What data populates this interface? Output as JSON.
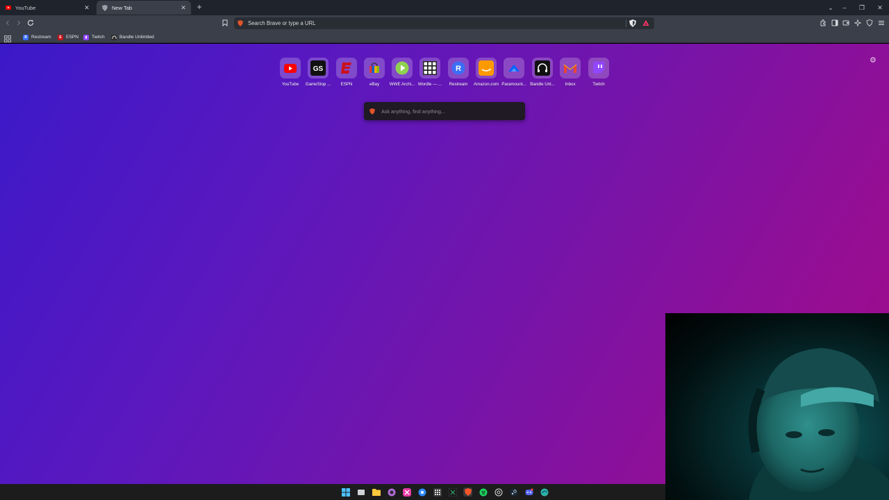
{
  "tabs": [
    {
      "title": "YouTube",
      "active": false,
      "favicon": "youtube-icon"
    },
    {
      "title": "New Tab",
      "active": true,
      "favicon": "brave-shield-icon"
    }
  ],
  "toolbar": {
    "omnibox_placeholder": "Search Brave or type a URL"
  },
  "bookmarks": [
    {
      "label": "Restream",
      "icon": "restream-icon",
      "color": "#3b6ef6"
    },
    {
      "label": "ESPN",
      "icon": "espn-icon",
      "color": "#c4151c"
    },
    {
      "label": "Twitch",
      "icon": "twitch-icon",
      "color": "#9146ff"
    },
    {
      "label": "Bandle Unlimited",
      "icon": "headphones-icon",
      "color": "#2b2b2b"
    }
  ],
  "top_sites": [
    {
      "label": "YouTube",
      "icon": "youtube-icon"
    },
    {
      "label": "GameStop ...",
      "icon": "gamestop-icon"
    },
    {
      "label": "ESPN",
      "icon": "espn-icon"
    },
    {
      "label": "eBay",
      "icon": "ebay-icon"
    },
    {
      "label": "WWE Archi...",
      "icon": "play-icon"
    },
    {
      "label": "Wordle — ...",
      "icon": "wordle-grid-icon"
    },
    {
      "label": "Restream",
      "icon": "restream-icon"
    },
    {
      "label": "Amazon.com",
      "icon": "amazon-icon"
    },
    {
      "label": "Paramount...",
      "icon": "paramount-icon"
    },
    {
      "label": "Bandle Unl...",
      "icon": "headphones-icon"
    },
    {
      "label": "Inbox",
      "icon": "gmail-icon"
    },
    {
      "label": "Twitch",
      "icon": "twitch-icon"
    }
  ],
  "search_box": {
    "placeholder": "Ask anything, find anything..."
  },
  "colors": {
    "gradient_start": "#3b19c8",
    "gradient_end": "#a10b8a",
    "toolbar": "#3a3f49",
    "tabstrip": "#1f232b"
  }
}
